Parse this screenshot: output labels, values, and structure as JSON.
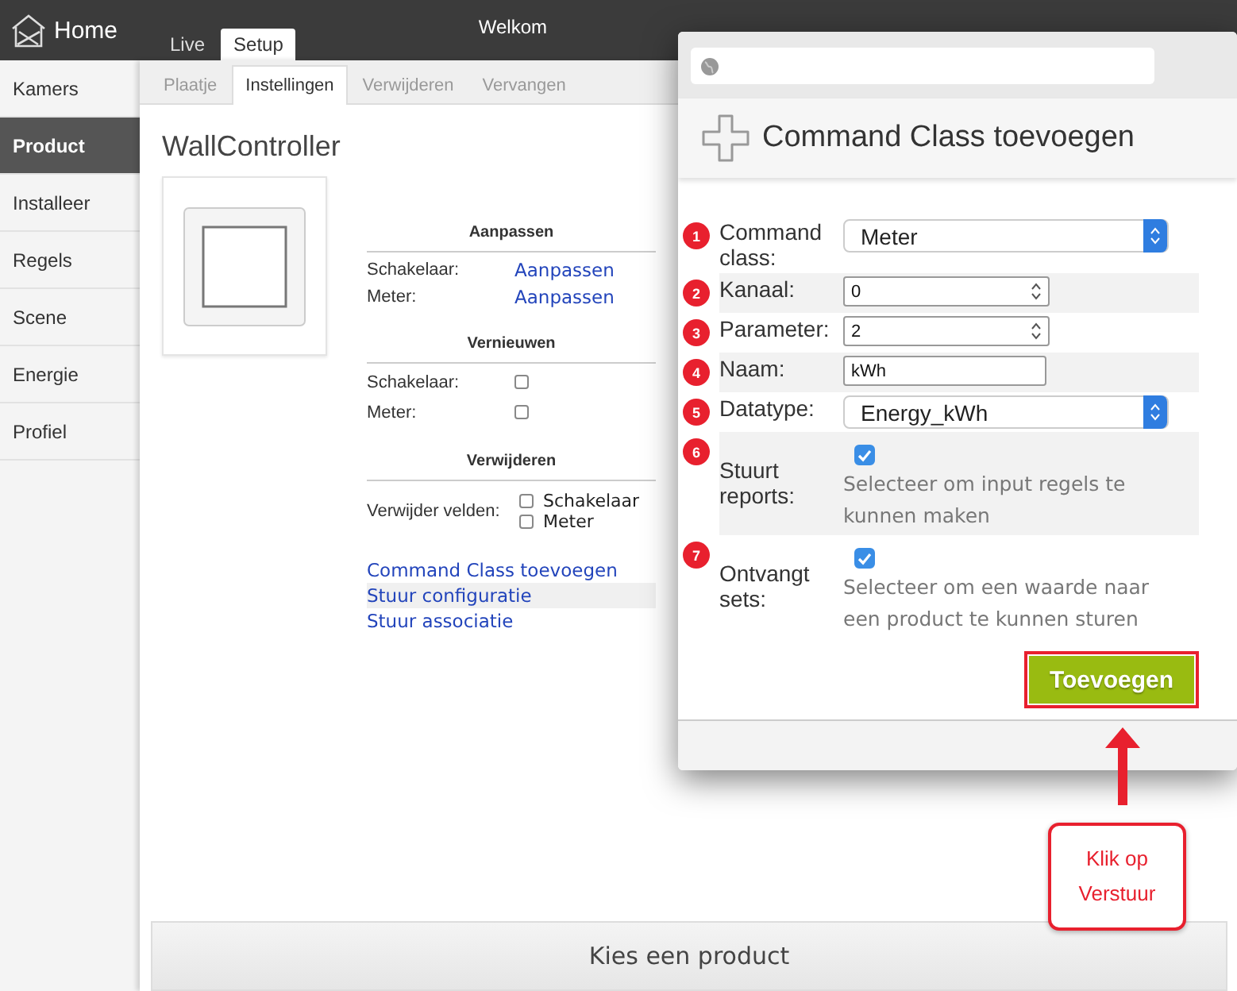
{
  "header": {
    "brand": "Home",
    "tabs": [
      {
        "label": "Live",
        "selected": false
      },
      {
        "label": "Setup",
        "selected": true
      }
    ],
    "welcome": "Welkom"
  },
  "sidebar": {
    "items": [
      {
        "label": "Kamers",
        "selected": false
      },
      {
        "label": "Product",
        "selected": true
      },
      {
        "label": "Installeer",
        "selected": false
      },
      {
        "label": "Regels",
        "selected": false
      },
      {
        "label": "Scene",
        "selected": false
      },
      {
        "label": "Energie",
        "selected": false
      },
      {
        "label": "Profiel",
        "selected": false
      }
    ]
  },
  "subtabs": [
    {
      "label": "Plaatje",
      "selected": false
    },
    {
      "label": "Instellingen",
      "selected": true
    },
    {
      "label": "Verwijderen",
      "selected": false
    },
    {
      "label": "Vervangen",
      "selected": false
    }
  ],
  "product": {
    "title": "WallController",
    "sections": [
      {
        "heading": "Aanpassen",
        "kind": "links",
        "rows": [
          {
            "label": "Schakelaar:",
            "link": "Aanpassen"
          },
          {
            "label": "Meter:",
            "link": "Aanpassen"
          }
        ]
      },
      {
        "heading": "Vernieuwen",
        "kind": "checks",
        "rows": [
          {
            "label": "Schakelaar:",
            "checked": false
          },
          {
            "label": "Meter:",
            "checked": false
          }
        ]
      },
      {
        "heading": "Verwijderen",
        "kind": "options",
        "label": "Verwijder velden:",
        "options": [
          {
            "label": "Schakelaar",
            "checked": false
          },
          {
            "label": "Meter",
            "checked": false
          }
        ]
      }
    ],
    "actions": [
      {
        "label": "Command Class toevoegen",
        "highlighted": false
      },
      {
        "label": "Stuur configuratie",
        "highlighted": true
      },
      {
        "label": "Stuur associatie",
        "highlighted": false
      }
    ]
  },
  "bottom_bar": "Kies een product",
  "dialog": {
    "title": "Command Class toevoegen",
    "fields": [
      {
        "number": "1",
        "label": "Command class:",
        "kind": "select",
        "value": "Meter"
      },
      {
        "number": "2",
        "label": "Kanaal:",
        "kind": "number",
        "value": "0"
      },
      {
        "number": "3",
        "label": "Parameter:",
        "kind": "number",
        "value": "2"
      },
      {
        "number": "4",
        "label": "Naam:",
        "kind": "text",
        "value": "kWh"
      },
      {
        "number": "5",
        "label": "Datatype:",
        "kind": "select",
        "value": "Energy_kWh"
      },
      {
        "number": "6",
        "label": "Stuurt reports:",
        "kind": "checkbox",
        "checked": true,
        "hint": "Selecteer om input regels te kunnen maken"
      },
      {
        "number": "7",
        "label": "Ontvangt sets:",
        "kind": "checkbox",
        "checked": true,
        "hint": "Selecteer om een waarde naar een product te kunnen sturen"
      }
    ],
    "button": "Toevoegen"
  },
  "callout": "Klik op Verstuur"
}
